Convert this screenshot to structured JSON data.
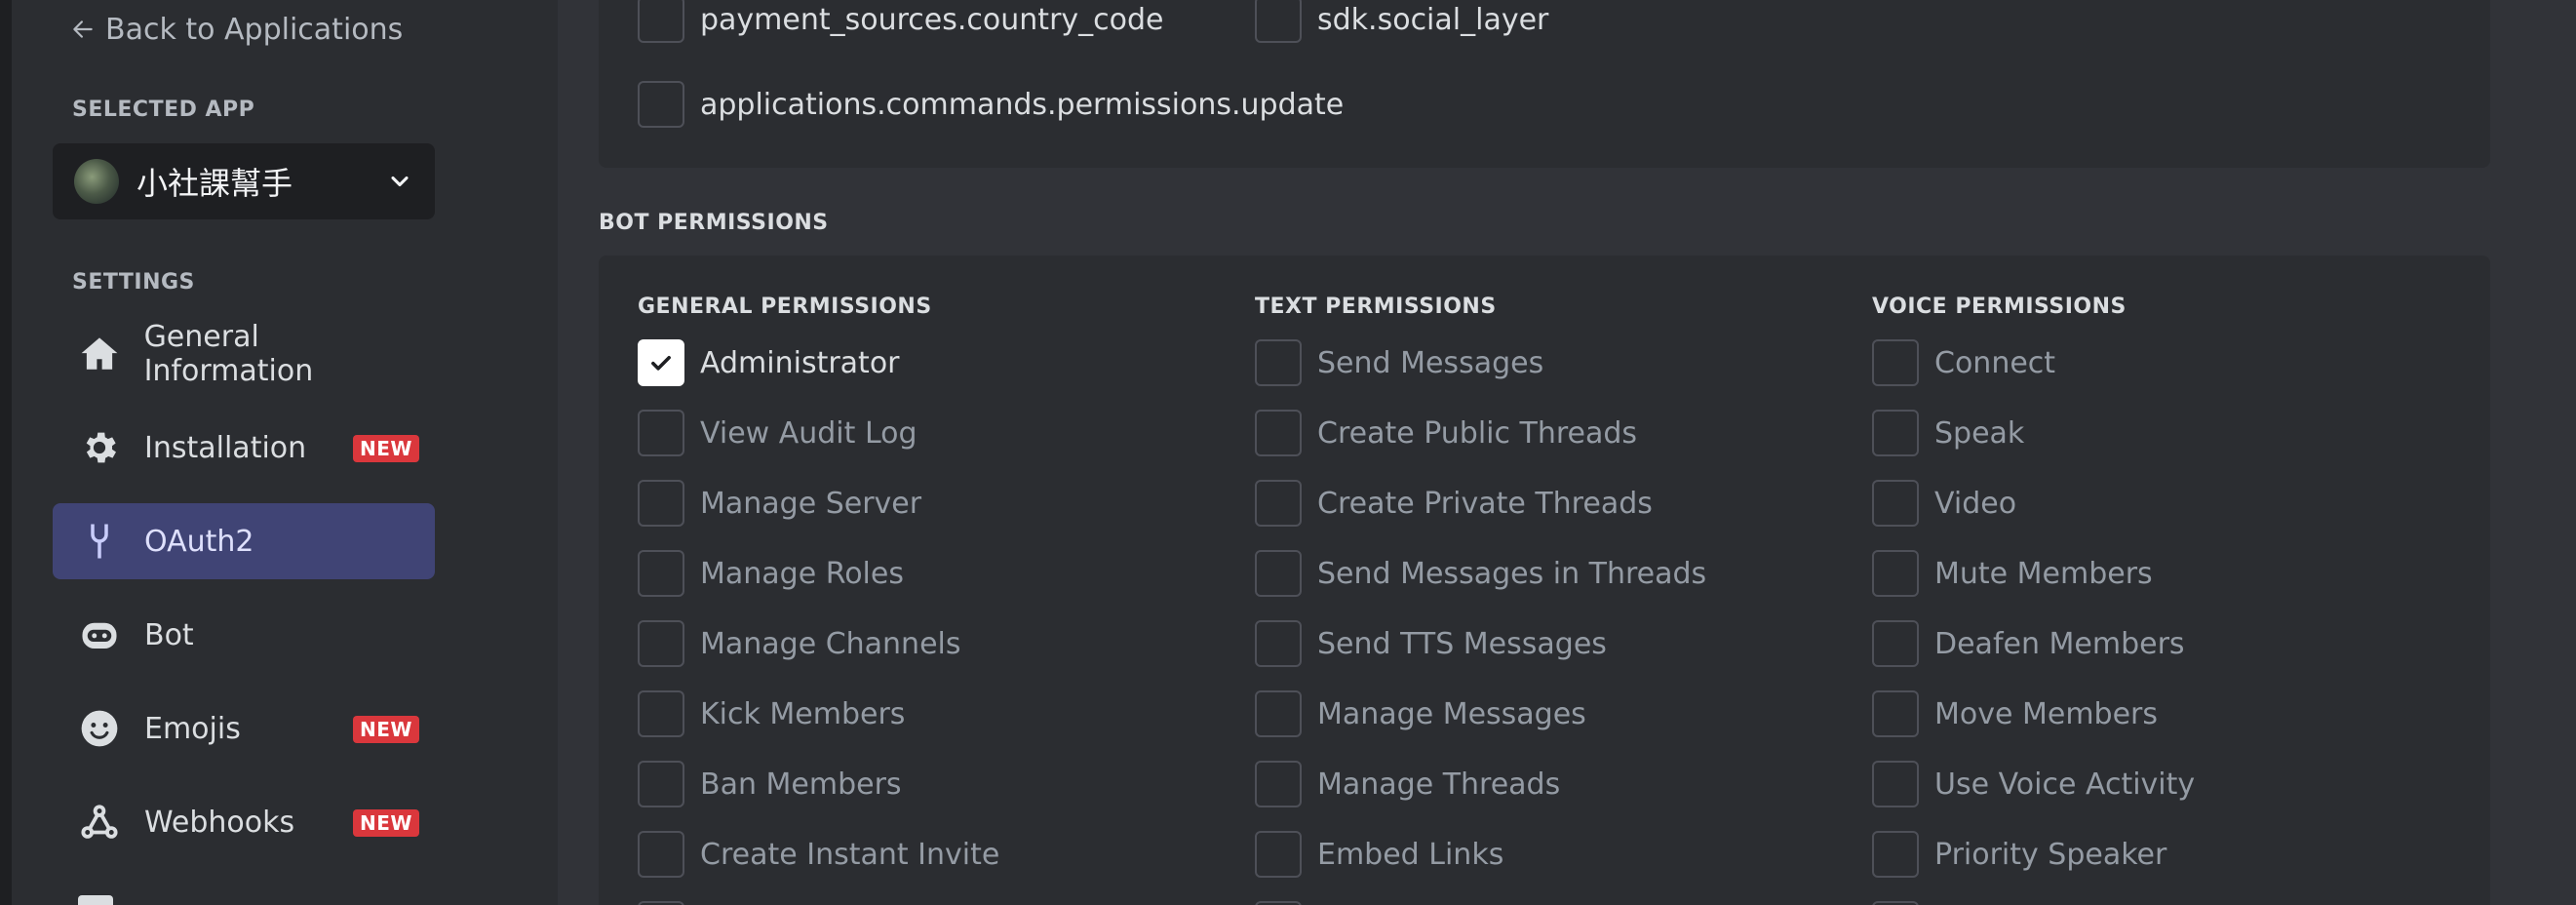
{
  "sidebar": {
    "back_label": "Back to Applications",
    "selected_app_title": "SELECTED APP",
    "app_name": "小社課幫手",
    "settings_title": "SETTINGS",
    "items": [
      {
        "label": "General Information",
        "icon": "home-icon",
        "badge": ""
      },
      {
        "label": "Installation",
        "icon": "gear-icon",
        "badge": "NEW"
      },
      {
        "label": "OAuth2",
        "icon": "wrench-icon",
        "badge": "",
        "active": true
      },
      {
        "label": "Bot",
        "icon": "bot-icon",
        "badge": ""
      },
      {
        "label": "Emojis",
        "icon": "smiley-icon",
        "badge": "NEW"
      },
      {
        "label": "Webhooks",
        "icon": "webhook-icon",
        "badge": "NEW"
      }
    ]
  },
  "scopes": {
    "items": [
      {
        "label": "payment_sources.country_code",
        "checked": false
      },
      {
        "label": "sdk.social_layer",
        "checked": false
      },
      {
        "label": "applications.commands.permissions.update",
        "checked": false
      }
    ]
  },
  "bot_permissions": {
    "title": "BOT PERMISSIONS",
    "general": {
      "title": "GENERAL PERMISSIONS",
      "items": [
        {
          "label": "Administrator",
          "checked": true
        },
        {
          "label": "View Audit Log",
          "checked": false
        },
        {
          "label": "Manage Server",
          "checked": false
        },
        {
          "label": "Manage Roles",
          "checked": false
        },
        {
          "label": "Manage Channels",
          "checked": false
        },
        {
          "label": "Kick Members",
          "checked": false
        },
        {
          "label": "Ban Members",
          "checked": false
        },
        {
          "label": "Create Instant Invite",
          "checked": false
        }
      ]
    },
    "text": {
      "title": "TEXT PERMISSIONS",
      "items": [
        {
          "label": "Send Messages",
          "checked": false
        },
        {
          "label": "Create Public Threads",
          "checked": false
        },
        {
          "label": "Create Private Threads",
          "checked": false
        },
        {
          "label": "Send Messages in Threads",
          "checked": false
        },
        {
          "label": "Send TTS Messages",
          "checked": false
        },
        {
          "label": "Manage Messages",
          "checked": false
        },
        {
          "label": "Manage Threads",
          "checked": false
        },
        {
          "label": "Embed Links",
          "checked": false
        }
      ]
    },
    "voice": {
      "title": "VOICE PERMISSIONS",
      "items": [
        {
          "label": "Connect",
          "checked": false
        },
        {
          "label": "Speak",
          "checked": false
        },
        {
          "label": "Video",
          "checked": false
        },
        {
          "label": "Mute Members",
          "checked": false
        },
        {
          "label": "Deafen Members",
          "checked": false
        },
        {
          "label": "Move Members",
          "checked": false
        },
        {
          "label": "Use Voice Activity",
          "checked": false
        },
        {
          "label": "Priority Speaker",
          "checked": false
        }
      ]
    }
  },
  "colors": {
    "active_nav": "#404475",
    "badge": "#da373c",
    "sidebar_bg": "#2b2d31",
    "main_bg": "#313338"
  }
}
